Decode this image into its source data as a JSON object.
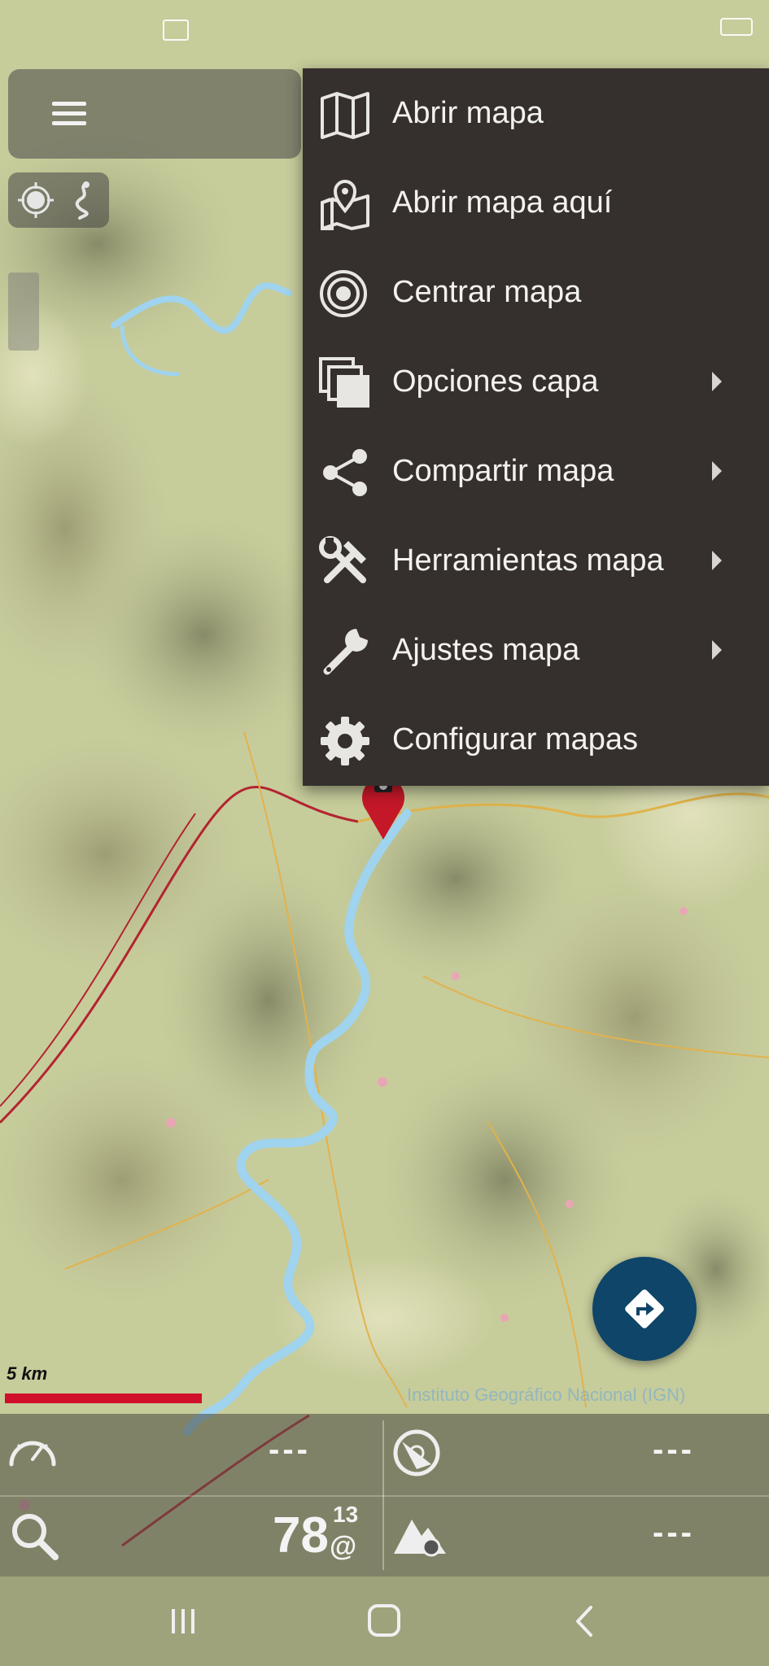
{
  "status_bar": {
    "icons": [
      "photo-icon",
      "battery-icon"
    ]
  },
  "controls": {
    "menu_icon": "hamburger-icon",
    "gps_icon": "crosshair-icon",
    "track_icon": "track-icon"
  },
  "context_menu": {
    "items": [
      {
        "label": "Abrir mapa",
        "icon": "folded-map-icon",
        "submenu": false
      },
      {
        "label": "Abrir mapa aquí",
        "icon": "map-pin-icon",
        "submenu": false
      },
      {
        "label": "Centrar mapa",
        "icon": "target-icon",
        "submenu": false
      },
      {
        "label": "Opciones capa",
        "icon": "layers-icon",
        "submenu": true
      },
      {
        "label": "Compartir mapa",
        "icon": "share-icon",
        "submenu": true
      },
      {
        "label": "Herramientas mapa",
        "icon": "tools-icon",
        "submenu": true
      },
      {
        "label": "Ajustes mapa",
        "icon": "wrench-icon",
        "submenu": true
      },
      {
        "label": "Configurar mapas",
        "icon": "gear-icon",
        "submenu": false
      }
    ]
  },
  "map": {
    "scale_label": "5 km",
    "attribution": "Instituto Geográfico Nacional (IGN)"
  },
  "fab": {
    "icon": "directions-icon"
  },
  "dashboard": {
    "speed": {
      "icon": "speedometer-icon",
      "value": "---"
    },
    "compass": {
      "icon": "compass-icon",
      "value": "---"
    },
    "search": {
      "icon": "magnifier-icon"
    },
    "satellites": {
      "count": "78",
      "superscript": "13",
      "symbol": "@"
    },
    "altitude": {
      "icon": "mountain-icon",
      "value": "---"
    }
  },
  "nav_bar": {
    "icons": [
      "recents-icon",
      "home-icon",
      "back-icon"
    ]
  },
  "colors": {
    "menu_bg": "#35302d",
    "fab_bg": "#0e4569",
    "scale_bar": "#d0102b",
    "river": "#9fd3ee"
  }
}
